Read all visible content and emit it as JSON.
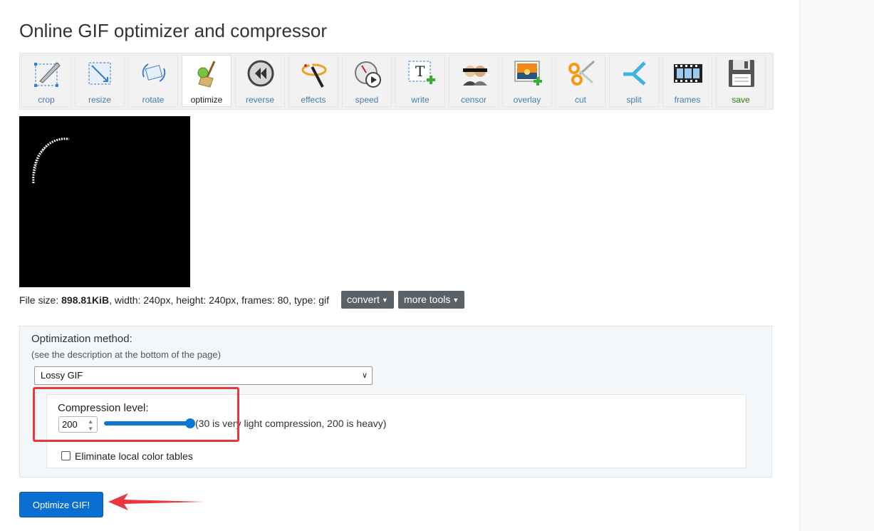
{
  "page": {
    "title": "Online GIF optimizer and compressor"
  },
  "toolbar": {
    "tools": [
      {
        "label": "crop",
        "icon": "crop-icon"
      },
      {
        "label": "resize",
        "icon": "resize-icon"
      },
      {
        "label": "rotate",
        "icon": "rotate-icon"
      },
      {
        "label": "optimize",
        "icon": "optimize-broom-icon",
        "active": true
      },
      {
        "label": "reverse",
        "icon": "reverse-icon"
      },
      {
        "label": "effects",
        "icon": "magic-wand-icon"
      },
      {
        "label": "speed",
        "icon": "stopwatch-icon"
      },
      {
        "label": "write",
        "icon": "text-add-icon"
      },
      {
        "label": "censor",
        "icon": "censor-faces-icon"
      },
      {
        "label": "overlay",
        "icon": "overlay-image-icon"
      },
      {
        "label": "cut",
        "icon": "scissors-icon"
      },
      {
        "label": "split",
        "icon": "split-arrows-icon"
      },
      {
        "label": "frames",
        "icon": "film-strip-icon"
      },
      {
        "label": "save",
        "icon": "floppy-disk-icon"
      }
    ]
  },
  "fileinfo": {
    "prefix": "File size: ",
    "size": "898.81KiB",
    "rest": ", width: 240px, height: 240px, frames: 80, type: gif"
  },
  "buttons": {
    "convert": "convert",
    "more_tools": "more tools",
    "optimize": "Optimize GIF!"
  },
  "options": {
    "method_label": "Optimization method:",
    "method_hint": "(see the description at the bottom of the page)",
    "method_selected": "Lossy GIF",
    "compression_label": "Compression level:",
    "compression_value": "200",
    "compression_min": 30,
    "compression_max": 200,
    "compression_hint": "(30 is very light compression, 200 is heavy)",
    "eliminate_label": "Eliminate local color tables",
    "eliminate_checked": false
  },
  "colors": {
    "accent": "#0b6ed1",
    "annotation": "#e8383d"
  }
}
